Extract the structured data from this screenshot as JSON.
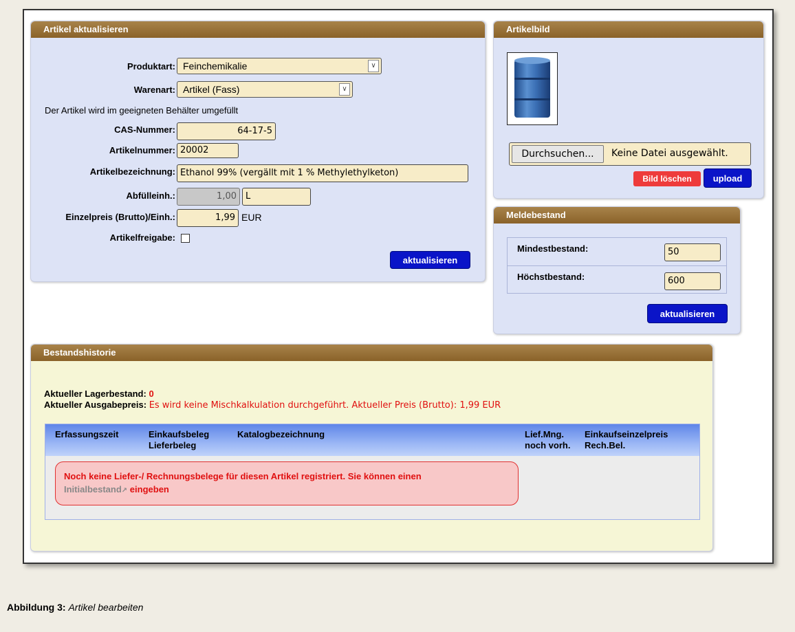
{
  "artikel_panel": {
    "title": "Artikel aktualisieren",
    "produktart_label": "Produktart:",
    "produktart_value": "Feinchemikalie",
    "warenart_label": "Warenart:",
    "warenart_value": "Artikel (Fass)",
    "info_text": "Der Artikel wird im geeigneten Behälter umgefüllt",
    "cas_label": "CAS-Nummer:",
    "cas_value": "64-17-5",
    "artikelnummer_label": "Artikelnummer:",
    "artikelnummer_value": "20002",
    "bezeichnung_label": "Artikelbezeichnung:",
    "bezeichnung_value": "Ethanol 99% (vergällt mit 1 % Methylethylketon)",
    "abfuell_label": "Abfülleinh.:",
    "abfuell_value": "1,00",
    "abfuell_unit": "L",
    "preis_label": "Einzelpreis (Brutto)/Einh.:",
    "preis_value": "1,99",
    "preis_unit": "EUR",
    "freigabe_label": "Artikelfreigabe:",
    "submit_label": "aktualisieren"
  },
  "bild_panel": {
    "title": "Artikelbild",
    "browse_label": "Durchsuchen...",
    "file_status": "Keine Datei ausgewählt.",
    "delete_label": "Bild löschen",
    "upload_label": "upload"
  },
  "melde_panel": {
    "title": "Meldebestand",
    "min_label": "Mindestbestand:",
    "min_value": "50",
    "max_label": "Höchstbestand:",
    "max_value": "600",
    "submit_label": "aktualisieren"
  },
  "historie_panel": {
    "title": "Bestandshistorie",
    "lager_label": "Aktueller Lagerbestand:",
    "lager_value": "0",
    "preis_label": "Aktueller Ausgabepreis:",
    "preis_value": "Es wird keine Mischkalkulation durchgeführt. Aktueller Preis (Brutto): 1,99 EUR",
    "columns": [
      {
        "line1": "Erfassungszeit",
        "line2": ""
      },
      {
        "line1": "Einkaufsbeleg",
        "line2": "Lieferbeleg"
      },
      {
        "line1": "Katalogbezeichnung",
        "line2": ""
      },
      {
        "line1": "Lief.Mng.",
        "line2": "noch vorh."
      },
      {
        "line1": "Einkaufseinzelpreis",
        "line2": "Rech.Bel."
      }
    ],
    "notice_text": "Noch keine Liefer-/ Rechnungsbelege für diesen Artikel registriert. Sie können einen",
    "notice_link": "Initialbestand",
    "notice_suffix": " eingeben"
  },
  "caption": {
    "label": "Abbildung 3:",
    "text": "Artikel bearbeiten"
  },
  "colors": {
    "panel_bg": "#dde3f6",
    "header_brown": "#8a6229",
    "button_blue": "#0a14c8",
    "button_red": "#ee3b3b",
    "input_bg": "#f7ecc8",
    "history_bg": "#f6f6d6",
    "alert_red": "#e01010"
  }
}
